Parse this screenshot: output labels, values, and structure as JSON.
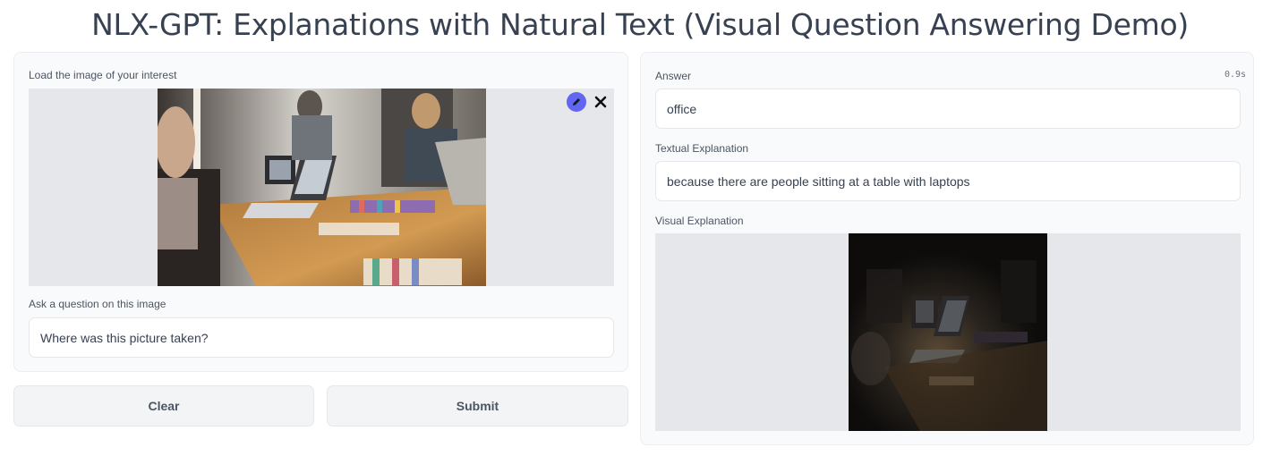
{
  "header": {
    "title": "NLX-GPT: Explanations with Natural Text (Visual Question Answering Demo)"
  },
  "input_panel": {
    "image_label": "Load the image of your interest",
    "image_description": "office meeting photo",
    "question_label": "Ask a question on this image",
    "question_value": "Where was this picture taken?"
  },
  "buttons": {
    "clear_label": "Clear",
    "submit_label": "Submit"
  },
  "output_panel": {
    "timer": "0.9s",
    "answer_label": "Answer",
    "answer_value": "office",
    "textual_label": "Textual Explanation",
    "textual_value": "because there are people sitting at a table with laptops",
    "visual_label": "Visual Explanation",
    "visual_description": "attention heatmap over photo"
  },
  "icons": {
    "edit": "pencil-icon",
    "close": "close-icon"
  },
  "colors": {
    "accent": "#6366f1",
    "panel_bg": "#f9fafb",
    "image_bg": "#e5e7eb"
  }
}
